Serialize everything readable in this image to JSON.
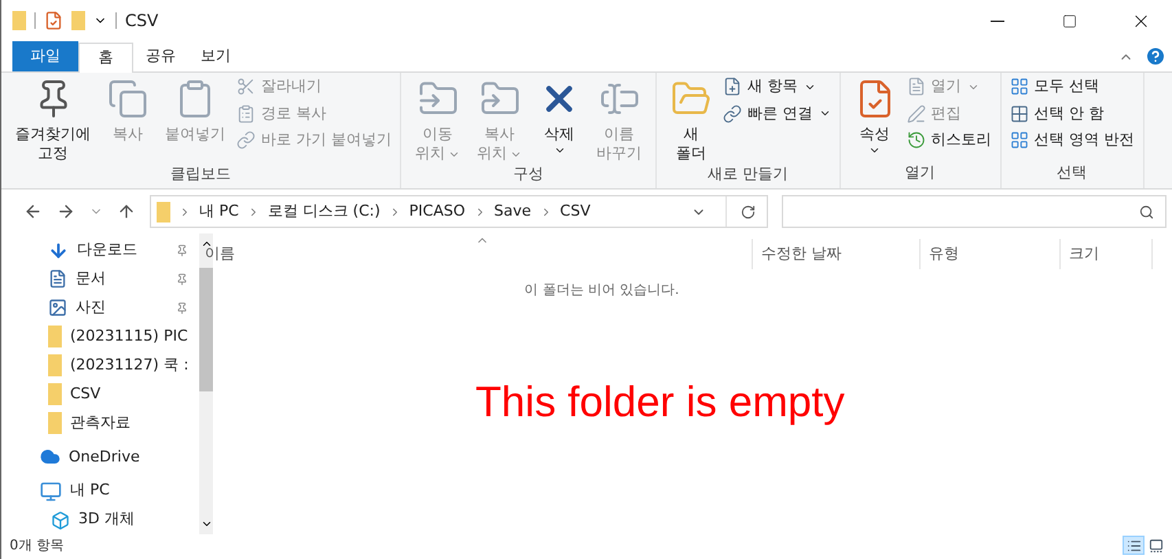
{
  "window": {
    "title": "CSV"
  },
  "tabs": [
    {
      "label": "파일",
      "kind": "file",
      "selected": false
    },
    {
      "label": "홈",
      "kind": "tab",
      "selected": true
    },
    {
      "label": "공유",
      "kind": "tab",
      "selected": false
    },
    {
      "label": "보기",
      "kind": "tab",
      "selected": false
    }
  ],
  "ribbon": [
    {
      "label": "클립보드",
      "items": [
        {
          "kind": "large",
          "lines": [
            "즐겨찾기에",
            "고정"
          ],
          "disabled": false,
          "dropdown": false
        },
        {
          "kind": "large",
          "lines": [
            "복사"
          ],
          "disabled": true,
          "dropdown": false
        },
        {
          "kind": "large",
          "lines": [
            "붙여넣기"
          ],
          "disabled": true,
          "dropdown": false
        },
        {
          "kind": "stack",
          "entries": [
            {
              "label": "잘라내기",
              "disabled": true,
              "dropdown": false
            },
            {
              "label": "경로 복사",
              "disabled": true,
              "dropdown": false
            },
            {
              "label": "바로 가기 붙여넣기",
              "disabled": true,
              "dropdown": false
            }
          ]
        }
      ]
    },
    {
      "label": "구성",
      "items": [
        {
          "kind": "large",
          "lines": [
            "이동",
            "위치"
          ],
          "disabled": true,
          "dropdown": true
        },
        {
          "kind": "large",
          "lines": [
            "복사",
            "위치"
          ],
          "disabled": true,
          "dropdown": true
        },
        {
          "kind": "large",
          "lines": [
            "삭제"
          ],
          "disabled": false,
          "dropdown": true
        },
        {
          "kind": "large",
          "lines": [
            "이름",
            "바꾸기"
          ],
          "disabled": true,
          "dropdown": false
        }
      ]
    },
    {
      "label": "새로 만들기",
      "items": [
        {
          "kind": "large",
          "lines": [
            "새",
            "폴더"
          ],
          "disabled": false,
          "dropdown": false
        },
        {
          "kind": "stack",
          "entries": [
            {
              "label": "새 항목",
              "disabled": false,
              "dropdown": true
            },
            {
              "label": "빠른 연결",
              "disabled": false,
              "dropdown": true
            }
          ]
        }
      ]
    },
    {
      "label": "열기",
      "items": [
        {
          "kind": "large",
          "lines": [
            "속성"
          ],
          "disabled": false,
          "dropdown": true
        },
        {
          "kind": "stack",
          "entries": [
            {
              "label": "열기",
              "disabled": true,
              "dropdown": true
            },
            {
              "label": "편집",
              "disabled": true,
              "dropdown": false
            },
            {
              "label": "히스토리",
              "disabled": false,
              "dropdown": false
            }
          ]
        }
      ]
    },
    {
      "label": "선택",
      "items": [
        {
          "kind": "stack",
          "entries": [
            {
              "label": "모두 선택",
              "disabled": false,
              "dropdown": false
            },
            {
              "label": "선택 안 함",
              "disabled": false,
              "dropdown": false
            },
            {
              "label": "선택 영역 반전",
              "disabled": false,
              "dropdown": false
            }
          ]
        }
      ]
    }
  ],
  "address": {
    "crumbs": [
      "내 PC",
      "로컬 디스크 (C:)",
      "PICASO",
      "Save",
      "CSV"
    ]
  },
  "sidebar": {
    "items": [
      {
        "kind": "download",
        "label": "다운로드",
        "pinned": true
      },
      {
        "kind": "document",
        "label": "문서",
        "pinned": true
      },
      {
        "kind": "picture",
        "label": "사진",
        "pinned": true
      },
      {
        "kind": "folder",
        "label": "(20231115) PIC",
        "pinned": false
      },
      {
        "kind": "folder",
        "label": "(20231127) 쿡 :",
        "pinned": false
      },
      {
        "kind": "folder",
        "label": "CSV",
        "pinned": false
      },
      {
        "kind": "folder",
        "label": "관측자료",
        "pinned": false
      },
      {
        "kind": "cloud",
        "label": "OneDrive",
        "pinned": false
      },
      {
        "kind": "pc",
        "label": "내 PC",
        "pinned": false,
        "children": [
          {
            "kind": "cube",
            "label": "3D 개체",
            "pinned": false
          }
        ]
      }
    ]
  },
  "table": {
    "columns": [
      "이름",
      "수정한 날짜",
      "유형",
      "크기"
    ]
  },
  "empty_message": "이 폴더는 비어 있습니다.",
  "annotation": "This folder is empty",
  "status_bar": {
    "count": "0개 항목",
    "views": [
      {
        "kind": "details",
        "selected": true
      },
      {
        "kind": "large",
        "selected": false
      }
    ]
  }
}
